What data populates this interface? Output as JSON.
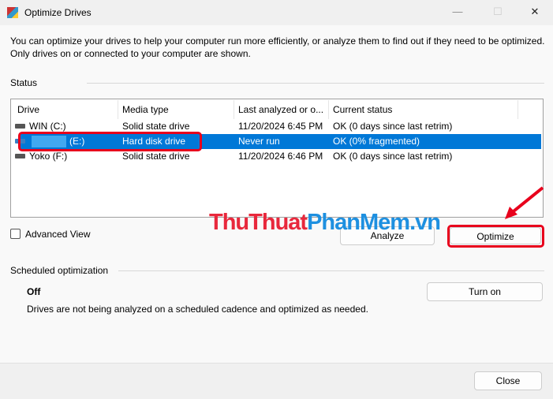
{
  "window": {
    "title": "Optimize Drives",
    "minimize": "—",
    "maximize": "☐",
    "close": "✕"
  },
  "description": "You can optimize your drives to help your computer run more efficiently, or analyze them to find out if they need to be optimized. Only drives on or connected to your computer are shown.",
  "status": {
    "label": "Status",
    "columns": [
      "Drive",
      "Media type",
      "Last analyzed or o...",
      "Current status"
    ],
    "rows": [
      {
        "drive": "WIN (C:)",
        "media": "Solid state drive",
        "last": "11/20/2024 6:45 PM",
        "status": "OK (0 days since last retrim)",
        "icon": "windows-drive-icon"
      },
      {
        "drive": "(E:)",
        "media": "Hard disk drive",
        "last": "Never run",
        "status": "OK (0% fragmented)",
        "icon": "hard-disk-icon",
        "selected": true
      },
      {
        "drive": "Yoko (F:)",
        "media": "Solid state drive",
        "last": "11/20/2024 6:46 PM",
        "status": "OK (0 days since last retrim)",
        "icon": "drive-icon"
      }
    ]
  },
  "advanced_view": "Advanced View",
  "analyze": "Analyze",
  "optimize": "Optimize",
  "scheduled": {
    "label": "Scheduled optimization",
    "state": "Off",
    "desc": "Drives are not being analyzed on a scheduled cadence and optimized as needed.",
    "turn_on": "Turn on"
  },
  "close": "Close",
  "watermark": {
    "part1": "ThuThuat",
    "part2": "PhanMem",
    "part3": ".vn"
  },
  "colors": {
    "accent": "#0078d7",
    "highlight": "#e8001c"
  }
}
